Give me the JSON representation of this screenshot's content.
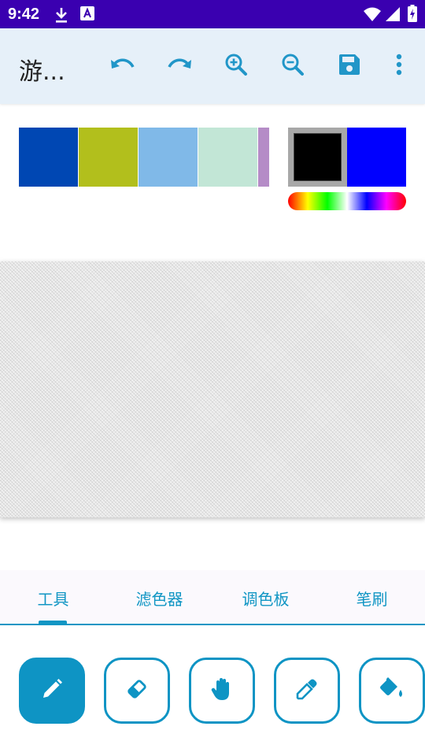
{
  "status_bar": {
    "time": "9:42",
    "left_icons": [
      "download-icon",
      "a-text-icon"
    ],
    "right_icons": [
      "wifi-icon",
      "signal-icon",
      "battery-charging-icon"
    ]
  },
  "toolbar": {
    "title": "游...",
    "actions": [
      "undo-icon",
      "redo-icon",
      "zoom-in-icon",
      "zoom-out-icon",
      "save-icon",
      "more-vert-icon"
    ],
    "icon_color": "#2196c8"
  },
  "palette": {
    "swatches": [
      "#0047b3",
      "#b2bf1c",
      "#80b9e8",
      "#c2e6d6",
      "#b58cc7"
    ],
    "current_color": "#000000",
    "secondary_color": "#0000ff"
  },
  "tabs": {
    "items": [
      {
        "label": "工具",
        "selected": true
      },
      {
        "label": "滤色器",
        "selected": false
      },
      {
        "label": "调色板",
        "selected": false
      },
      {
        "label": "笔刷",
        "selected": false
      }
    ],
    "accent": "#1196c4"
  },
  "tools": {
    "items": [
      {
        "icon": "pencil-icon",
        "active": true
      },
      {
        "icon": "eraser-icon",
        "active": false
      },
      {
        "icon": "hand-icon",
        "active": false
      },
      {
        "icon": "eyedropper-icon",
        "active": false
      },
      {
        "icon": "paint-bucket-icon",
        "active": false
      }
    ]
  }
}
